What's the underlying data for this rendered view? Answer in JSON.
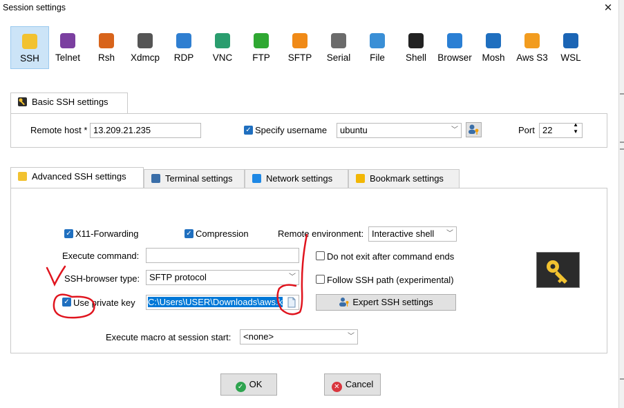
{
  "window": {
    "title": "Session settings",
    "close_glyph": "✕"
  },
  "protocols": [
    {
      "label": "SSH",
      "icon": "ssh-key-icon",
      "color": "#f2c230",
      "selected": true
    },
    {
      "label": "Telnet",
      "icon": "telnet-icon",
      "color": "#7b3fa0"
    },
    {
      "label": "Rsh",
      "icon": "rsh-icon",
      "color": "#d8641b"
    },
    {
      "label": "Xdmcp",
      "icon": "xdmcp-icon",
      "color": "#555555"
    },
    {
      "label": "RDP",
      "icon": "rdp-icon",
      "color": "#2f7fd1"
    },
    {
      "label": "VNC",
      "icon": "vnc-icon",
      "color": "#2a9d6e"
    },
    {
      "label": "FTP",
      "icon": "ftp-icon",
      "color": "#2fa832"
    },
    {
      "label": "SFTP",
      "icon": "sftp-icon",
      "color": "#f08a17"
    },
    {
      "label": "Serial",
      "icon": "serial-icon",
      "color": "#6b6b6b"
    },
    {
      "label": "File",
      "icon": "file-icon",
      "color": "#3a8fd6"
    },
    {
      "label": "Shell",
      "icon": "shell-icon",
      "color": "#222222"
    },
    {
      "label": "Browser",
      "icon": "browser-globe-icon",
      "color": "#2a7fd4"
    },
    {
      "label": "Mosh",
      "icon": "mosh-icon",
      "color": "#1f6fbf"
    },
    {
      "label": "Aws S3",
      "icon": "aws-s3-icon",
      "color": "#f29c1f"
    },
    {
      "label": "WSL",
      "icon": "wsl-icon",
      "color": "#1b65b5"
    }
  ],
  "basic": {
    "tab_label": "Basic SSH settings",
    "remote_host_label": "Remote host *",
    "remote_host_value": "13.209.21.235",
    "specify_username_label": "Specify username",
    "username_value": "ubuntu",
    "port_label": "Port",
    "port_value": "22"
  },
  "tabs": [
    {
      "label": "Advanced SSH settings",
      "icon": "key-icon",
      "color": "#f2c230"
    },
    {
      "label": "Terminal settings",
      "icon": "terminal-icon",
      "color": "#3a6ea8"
    },
    {
      "label": "Network settings",
      "icon": "network-icon",
      "color": "#1e88e5"
    },
    {
      "label": "Bookmark settings",
      "icon": "star-icon",
      "color": "#f2b705"
    }
  ],
  "advanced": {
    "x11_label": "X11-Forwarding",
    "compression_label": "Compression",
    "remote_env_label": "Remote environment:",
    "remote_env_value": "Interactive shell",
    "execute_command_label": "Execute command:",
    "execute_command_value": "",
    "do_not_exit_label": "Do not exit after command ends",
    "ssh_browser_label": "SSH-browser type:",
    "ssh_browser_value": "SFTP protocol",
    "follow_ssh_label": "Follow SSH path (experimental)",
    "private_key_label": "Use private key",
    "private_key_value": "C:\\Users\\USER\\Downloads\\aws.k",
    "expert_label": "Expert SSH settings",
    "macro_label": "Execute macro at session start:",
    "macro_value": "<none>"
  },
  "footer": {
    "ok_label": "OK",
    "cancel_label": "Cancel"
  },
  "annotation_color": "#e0141e"
}
